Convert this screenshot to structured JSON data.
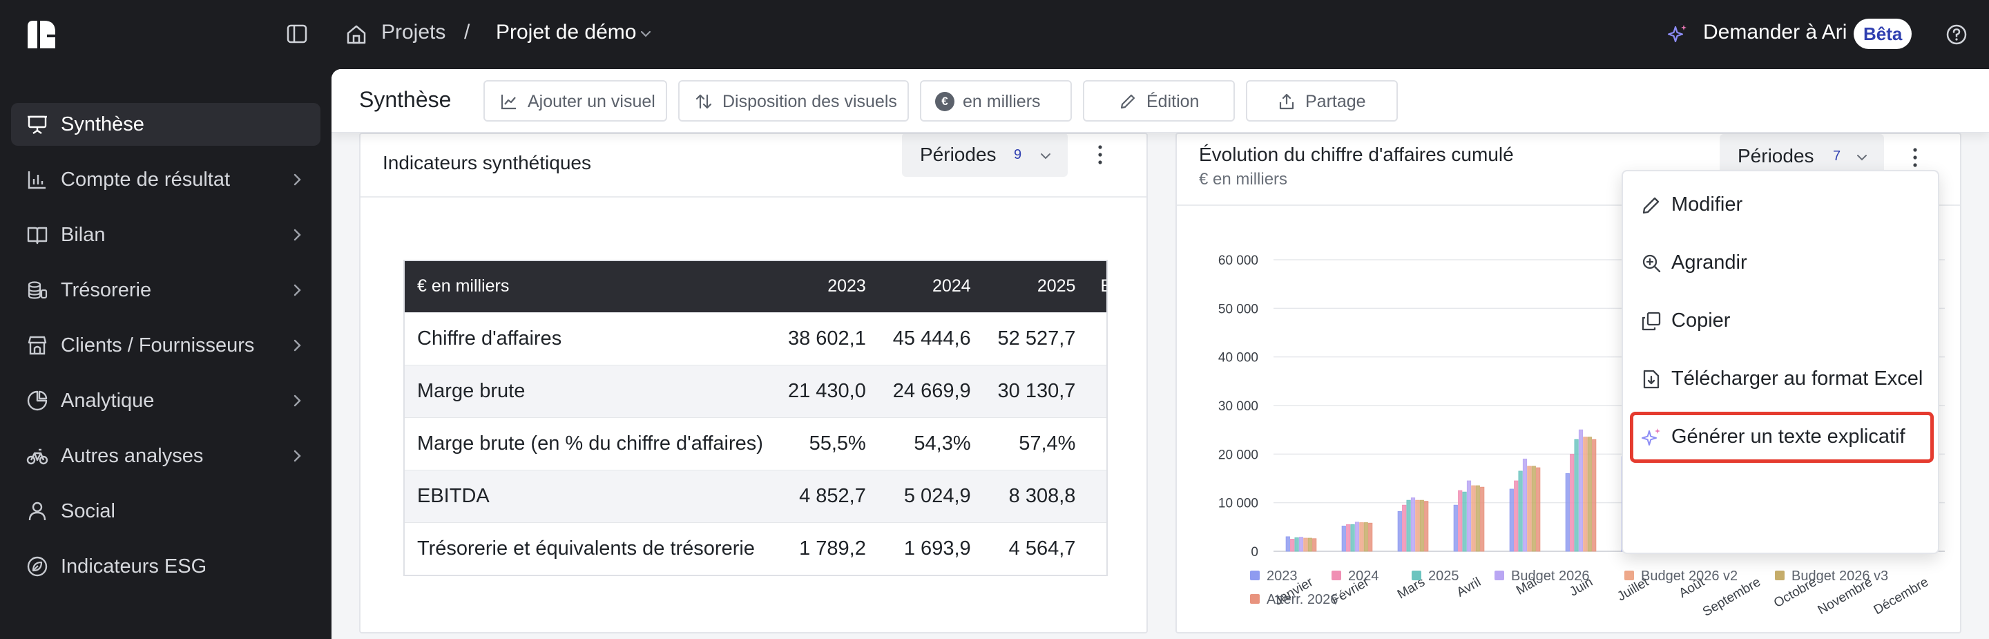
{
  "topbar": {
    "breadcrumb": [
      "Projets",
      "/",
      "Projet de démo"
    ],
    "ask_label": "Demander à Ari",
    "beta_badge": "Bêta"
  },
  "sidebar": {
    "items": [
      {
        "label": "Synthèse",
        "icon": "presentation-icon",
        "active": true,
        "chevron": false
      },
      {
        "label": "Compte de résultat",
        "icon": "bar-chart-icon",
        "active": false,
        "chevron": true
      },
      {
        "label": "Bilan",
        "icon": "book-icon",
        "active": false,
        "chevron": true
      },
      {
        "label": "Trésorerie",
        "icon": "coins-icon",
        "active": false,
        "chevron": true
      },
      {
        "label": "Clients / Fournisseurs",
        "icon": "store-icon",
        "active": false,
        "chevron": true
      },
      {
        "label": "Analytique",
        "icon": "pie-chart-icon",
        "active": false,
        "chevron": true
      },
      {
        "label": "Autres analyses",
        "icon": "bike-icon",
        "active": false,
        "chevron": true
      },
      {
        "label": "Social",
        "icon": "user-icon",
        "active": false,
        "chevron": false
      },
      {
        "label": "Indicateurs ESG",
        "icon": "leaf-circle-icon",
        "active": false,
        "chevron": false
      }
    ]
  },
  "toolbar": {
    "title": "Synthèse",
    "add_visual": "Ajouter un visuel",
    "layout": "Disposition des visuels",
    "units": "en milliers",
    "edit": "Édition",
    "share": "Partage"
  },
  "card1": {
    "title": "Indicateurs synthétiques",
    "periods_label": "Périodes",
    "periods_count": "9",
    "table": {
      "headers": [
        "€ en milliers",
        "2023",
        "2024",
        "2025",
        "B"
      ],
      "rows": [
        [
          "Chiffre d'affaires",
          "38 602,1",
          "45 444,6",
          "52 527,7",
          ""
        ],
        [
          "Marge brute",
          "21 430,0",
          "24 669,9",
          "30 130,7",
          ""
        ],
        [
          "Marge brute (en % du chiffre d'affaires)",
          "55,5%",
          "54,3%",
          "57,4%",
          ""
        ],
        [
          "EBITDA",
          "4 852,7",
          "5 024,9",
          "8 308,8",
          ""
        ],
        [
          "Trésorerie et équivalents de trésorerie",
          "1 789,2",
          "1 693,9",
          "4 564,7",
          ""
        ]
      ]
    }
  },
  "card2": {
    "title": "Évolution du chiffre d'affaires cumulé",
    "subtitle": "€ en milliers",
    "periods_label": "Périodes",
    "periods_count": "7"
  },
  "menu": {
    "items": [
      {
        "label": "Modifier",
        "icon": "pencil-icon"
      },
      {
        "label": "Agrandir",
        "icon": "zoom-in-icon"
      },
      {
        "label": "Copier",
        "icon": "copy-icon"
      },
      {
        "label": "Télécharger au format Excel",
        "icon": "file-download-icon"
      },
      {
        "label": "Générer un texte explicatif",
        "icon": "sparkles-icon",
        "highlighted": true
      }
    ]
  },
  "colors": {
    "2023": "#8f9bf0",
    "2024": "#f08fb4",
    "2025": "#6cc4bf",
    "Budget 2026": "#b9a6f3",
    "Budget 2026 v2": "#eea88a",
    "Budget 2026 v3": "#c6ad6a",
    "Atterr. 2026": "#e8937e",
    "highlight": "#e53b2f",
    "accent": "#2f3fb0"
  },
  "chart_data": {
    "type": "bar",
    "categories": [
      "Janvier",
      "Février",
      "Mars",
      "Avril",
      "Mai",
      "Juin",
      "Juillet",
      "Août",
      "Septembre",
      "Octobre",
      "Novembre",
      "Décembre"
    ],
    "ylim": [
      0,
      60000
    ],
    "yticks": [
      "0",
      "10 000",
      "20 000",
      "30 000",
      "40 000",
      "50 000",
      "60 000"
    ],
    "legend_position": "bottom",
    "grid": true,
    "series": [
      {
        "name": "2023",
        "values": [
          3000,
          5200,
          8200,
          9500,
          12800,
          16000,
          19500,
          null,
          null,
          null,
          null,
          null
        ]
      },
      {
        "name": "2024",
        "values": [
          2500,
          5500,
          9500,
          12500,
          14500,
          20000,
          21500,
          null,
          null,
          null,
          null,
          null
        ]
      },
      {
        "name": "2025",
        "values": [
          2800,
          5500,
          10500,
          12200,
          16500,
          23000,
          null,
          null,
          null,
          null,
          null,
          null
        ]
      },
      {
        "name": "Budget 2026",
        "values": [
          2900,
          6000,
          11000,
          14500,
          19000,
          25000,
          null,
          null,
          null,
          null,
          null,
          null
        ]
      },
      {
        "name": "Budget 2026 v2",
        "values": [
          2700,
          5900,
          10500,
          13500,
          17500,
          23500,
          null,
          null,
          null,
          null,
          null,
          null
        ]
      },
      {
        "name": "Budget 2026 v3",
        "values": [
          2700,
          5900,
          10500,
          13500,
          17500,
          23500,
          null,
          null,
          null,
          null,
          null,
          null
        ]
      },
      {
        "name": "Atterr. 2026",
        "values": [
          2600,
          5800,
          10300,
          13200,
          17200,
          23000,
          null,
          null,
          null,
          null,
          null,
          null
        ]
      }
    ]
  }
}
